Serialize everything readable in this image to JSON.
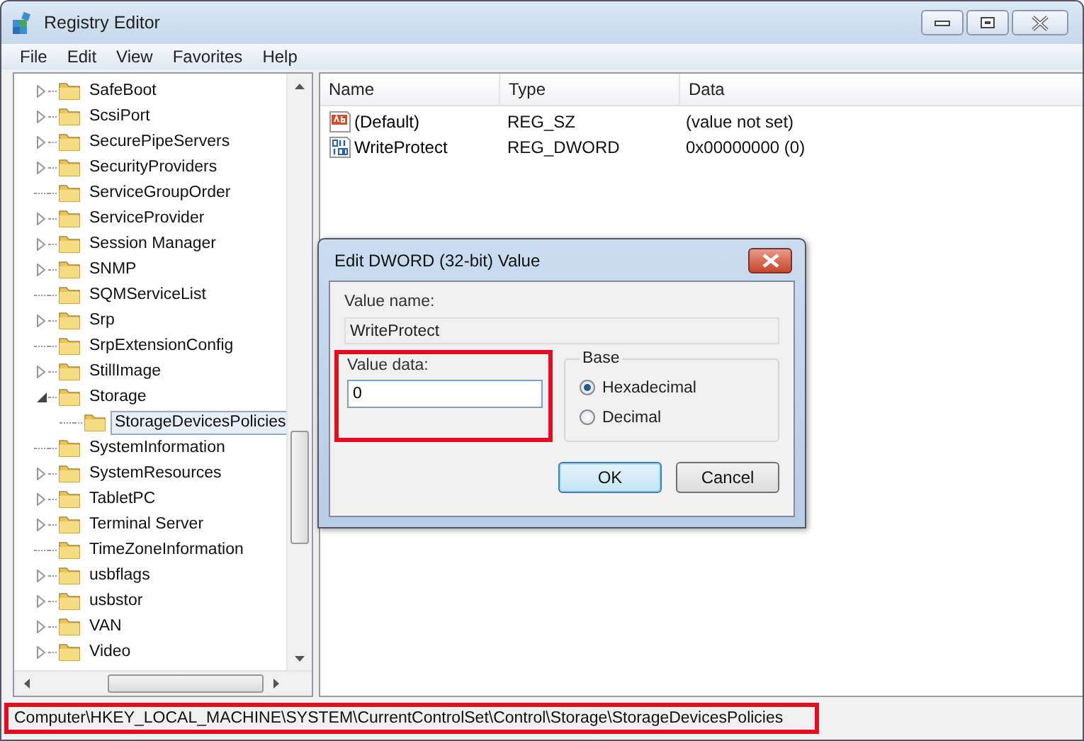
{
  "window": {
    "title": "Registry Editor"
  },
  "menu": [
    "File",
    "Edit",
    "View",
    "Favorites",
    "Help"
  ],
  "tree": {
    "items": [
      {
        "label": "SafeBoot",
        "has_children": true,
        "expanded": false,
        "selected": false
      },
      {
        "label": "ScsiPort",
        "has_children": true,
        "expanded": false,
        "selected": false
      },
      {
        "label": "SecurePipeServers",
        "has_children": true,
        "expanded": false,
        "selected": false
      },
      {
        "label": "SecurityProviders",
        "has_children": true,
        "expanded": false,
        "selected": false
      },
      {
        "label": "ServiceGroupOrder",
        "has_children": false,
        "selected": false
      },
      {
        "label": "ServiceProvider",
        "has_children": true,
        "expanded": false,
        "selected": false
      },
      {
        "label": "Session Manager",
        "has_children": true,
        "expanded": false,
        "selected": false
      },
      {
        "label": "SNMP",
        "has_children": true,
        "expanded": false,
        "selected": false
      },
      {
        "label": "SQMServiceList",
        "has_children": false,
        "selected": false
      },
      {
        "label": "Srp",
        "has_children": true,
        "expanded": false,
        "selected": false
      },
      {
        "label": "SrpExtensionConfig",
        "has_children": false,
        "selected": false
      },
      {
        "label": "StillImage",
        "has_children": true,
        "expanded": false,
        "selected": false
      },
      {
        "label": "Storage",
        "has_children": true,
        "expanded": true,
        "selected": false,
        "children": [
          {
            "label": "StorageDevicesPolicies",
            "has_children": false,
            "selected": true
          }
        ]
      },
      {
        "label": "SystemInformation",
        "has_children": false,
        "selected": false
      },
      {
        "label": "SystemResources",
        "has_children": true,
        "expanded": false,
        "selected": false
      },
      {
        "label": "TabletPC",
        "has_children": true,
        "expanded": false,
        "selected": false
      },
      {
        "label": "Terminal Server",
        "has_children": true,
        "expanded": false,
        "selected": false
      },
      {
        "label": "TimeZoneInformation",
        "has_children": false,
        "selected": false
      },
      {
        "label": "usbflags",
        "has_children": true,
        "expanded": false,
        "selected": false
      },
      {
        "label": "usbstor",
        "has_children": true,
        "expanded": false,
        "selected": false
      },
      {
        "label": "VAN",
        "has_children": true,
        "expanded": false,
        "selected": false
      },
      {
        "label": "Video",
        "has_children": true,
        "expanded": false,
        "selected": false
      }
    ]
  },
  "values": {
    "columns": [
      "Name",
      "Type",
      "Data"
    ],
    "rows": [
      {
        "kind": "string",
        "name": "(Default)",
        "type": "REG_SZ",
        "data": "(value not set)"
      },
      {
        "kind": "binary",
        "name": "WriteProtect",
        "type": "REG_DWORD",
        "data": "0x00000000 (0)"
      }
    ]
  },
  "dialog": {
    "title": "Edit DWORD (32-bit) Value",
    "value_name_label": "Value name:",
    "value_name": "WriteProtect",
    "value_data_label": "Value data:",
    "value_data": "0",
    "value_data_highlighted": true,
    "base_label": "Base",
    "base_options": [
      {
        "label": "Hexadecimal",
        "selected": true
      },
      {
        "label": "Decimal",
        "selected": false
      }
    ],
    "buttons": [
      {
        "label": "OK",
        "default": true
      },
      {
        "label": "Cancel",
        "default": false
      }
    ]
  },
  "status_bar": {
    "path": "Computer\\HKEY_LOCAL_MACHINE\\SYSTEM\\CurrentControlSet\\Control\\Storage\\StorageDevicesPolicies",
    "highlighted": true
  }
}
